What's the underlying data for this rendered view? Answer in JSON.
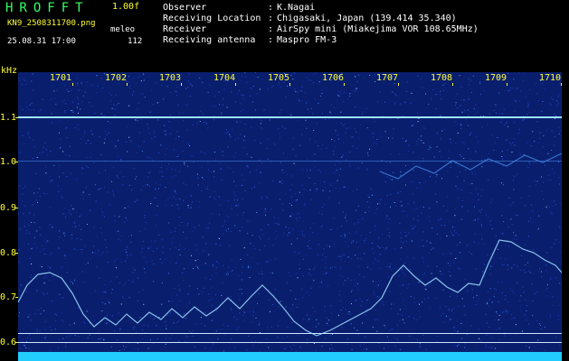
{
  "header": {
    "app_name": "HROFFT",
    "version": "1.00f",
    "filename": "KN9_2508311700.png",
    "station": "meleo",
    "datetime": "25.08.31 17:00",
    "count": "112"
  },
  "info": {
    "observer_label": "Observer",
    "observer_value": "K.Nagai",
    "location_label": "Receiving Location",
    "location_value": "Chigasaki, Japan (139.414 35.340)",
    "receiver_label": "Receiver",
    "receiver_value": "AirSpy mini (Miakejima VOR 108.65MHz)",
    "antenna_label": "Receiving antenna",
    "antenna_value": "Maspro FM-3",
    "separator": ":"
  },
  "axis": {
    "unit": "kHz",
    "y_labels": [
      "1.1",
      "1.0",
      "0.9",
      "0.8",
      "0.7",
      "0.6"
    ],
    "x_labels": [
      "1701",
      "1702",
      "1703",
      "1704",
      "1705",
      "1706",
      "1707",
      "1708",
      "1709",
      "1710"
    ]
  },
  "colors": {
    "background": "#000000",
    "text_yellow": "#ffff33",
    "text_white": "#ffffff",
    "logo_green": "#33ff66",
    "spectrogram_base": "#0a1e6e",
    "noise_bar": "#22ccff"
  }
}
